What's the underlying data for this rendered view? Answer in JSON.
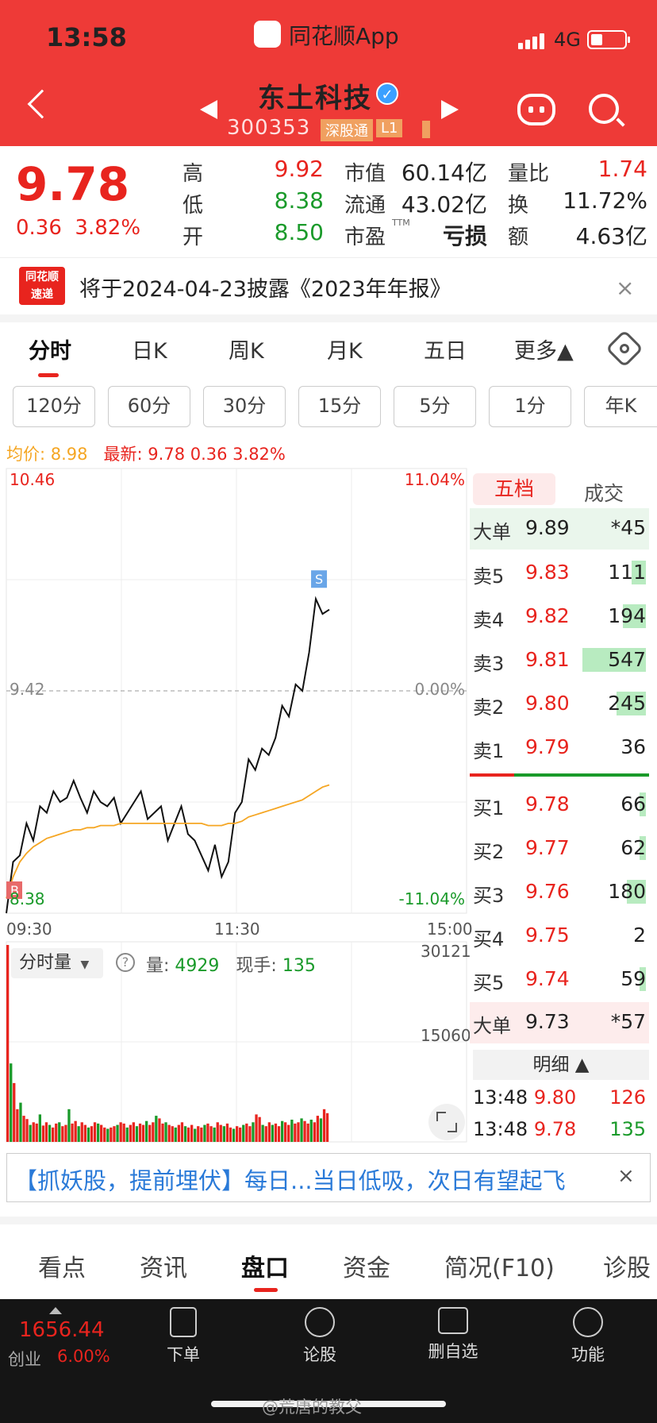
{
  "status_bar": {
    "time": "13:58",
    "app_name": "同花顺App",
    "network": "4G"
  },
  "header": {
    "stock_name": "东土科技",
    "stock_code": "300353",
    "tag_connect": "深股通",
    "tag_level": "L1"
  },
  "quote": {
    "price": "9.78",
    "change": "0.36",
    "change_pct": "3.82%",
    "fields": [
      {
        "label": "高",
        "value": "9.92",
        "color": "#e8241e"
      },
      {
        "label": "低",
        "value": "8.38",
        "color": "#1a9a2a"
      },
      {
        "label": "开",
        "value": "8.50",
        "color": "#1a9a2a"
      },
      {
        "label": "市值",
        "value": "60.14亿",
        "color": "#222222"
      },
      {
        "label": "流通",
        "value": "43.02亿",
        "color": "#222222"
      },
      {
        "label": "市盈",
        "value": "亏损",
        "color": "#222222"
      },
      {
        "label": "量比",
        "value": "1.74",
        "color": "#e8241e"
      },
      {
        "label": "换",
        "value": "11.72%",
        "color": "#222222"
      },
      {
        "label": "额",
        "value": "4.63亿",
        "color": "#222222"
      }
    ],
    "ttm_mark": "TTM"
  },
  "notice": {
    "logo_line1": "同花顺",
    "logo_line2": "速递",
    "text": "将于2024-04-23披露《2023年年报》",
    "close": "×"
  },
  "chart_tabs": [
    "分时",
    "日K",
    "周K",
    "月K",
    "五日",
    "更多▲"
  ],
  "periods": [
    "120分",
    "60分",
    "30分",
    "15分",
    "5分",
    "1分",
    "年K"
  ],
  "summary": {
    "avg_label": "均价: 8.98",
    "latest_label": "最新: 9.78  0.36  3.82%"
  },
  "chart_data": {
    "type": "line",
    "ylim": [
      8.38,
      10.46
    ],
    "y_ticks": {
      "top": "10.46",
      "mid": "9.42",
      "bottom": "8.38"
    },
    "pct_ticks": {
      "top": "11.04%",
      "mid": "0.00%",
      "bottom": "-11.04%"
    },
    "x_ticks": [
      "09:30",
      "11:30",
      "15:00"
    ],
    "marks": {
      "buy": "B",
      "sell": "S"
    },
    "series": [
      {
        "name": "最新",
        "color": "#111111",
        "values": [
          8.38,
          8.62,
          8.65,
          8.8,
          8.72,
          8.88,
          8.85,
          8.95,
          8.9,
          8.92,
          9.0,
          8.92,
          8.85,
          8.95,
          8.9,
          8.88,
          8.92,
          8.8,
          8.85,
          8.9,
          8.95,
          8.82,
          8.85,
          8.88,
          8.72,
          8.8,
          8.88,
          8.75,
          8.72,
          8.65,
          8.58,
          8.7,
          8.55,
          8.62,
          8.85,
          8.9,
          9.1,
          9.05,
          9.15,
          9.12,
          9.2,
          9.35,
          9.3,
          9.45,
          9.42,
          9.6,
          9.85,
          9.78,
          9.8
        ]
      },
      {
        "name": "均价",
        "color": "#f5a623",
        "values": [
          8.45,
          8.55,
          8.62,
          8.66,
          8.69,
          8.71,
          8.73,
          8.74,
          8.75,
          8.76,
          8.77,
          8.77,
          8.78,
          8.78,
          8.79,
          8.79,
          8.79,
          8.8,
          8.8,
          8.8,
          8.8,
          8.8,
          8.8,
          8.8,
          8.8,
          8.8,
          8.8,
          8.8,
          8.8,
          8.8,
          8.79,
          8.79,
          8.79,
          8.8,
          8.8,
          8.81,
          8.83,
          8.84,
          8.85,
          8.86,
          8.87,
          8.88,
          8.89,
          8.9,
          8.91,
          8.93,
          8.95,
          8.97,
          8.98
        ]
      }
    ]
  },
  "volume": {
    "selector": "分时量",
    "help": "?",
    "volume_label": "量:",
    "volume_value": "4929",
    "hand_label": "现手:",
    "hand_value": "135",
    "y_ticks": [
      "30121",
      "15060"
    ],
    "values": [
      30121,
      12000,
      9000,
      5000,
      6000,
      4000,
      3500,
      2600,
      3000,
      2800,
      4200,
      2500,
      3000,
      2600,
      2200,
      2800,
      3000,
      2400,
      2600,
      5000,
      2800,
      3200,
      2400,
      3000,
      2600,
      2200,
      2400,
      3000,
      2800,
      2600,
      2200,
      2000,
      2200,
      2400,
      2600,
      3000,
      2800,
      2200,
      2600,
      3000,
      2400,
      2800,
      2600,
      3200,
      2600,
      3000,
      4000,
      3600,
      2800,
      3000,
      2600,
      2400,
      2200,
      2600,
      3000,
      2400,
      2200,
      2600,
      2000,
      2400,
      2200,
      2600,
      2800,
      2400,
      2200,
      3000,
      2600,
      2400,
      2800,
      2200,
      2000,
      2400,
      2200,
      2600,
      2800,
      2400,
      3000,
      4200,
      3800,
      2600,
      2400,
      3000,
      2600,
      2800,
      2400,
      3200,
      3000,
      2600,
      3400,
      2800,
      3000,
      3600,
      3200,
      2800,
      3400,
      3000,
      4000,
      3600,
      5000,
      4400
    ]
  },
  "order_book": {
    "tab_active": "五档",
    "tab_other": "成交",
    "big_sell": {
      "label": "大单",
      "price": "9.89",
      "qty": "*45"
    },
    "asks": [
      {
        "label": "卖5",
        "price": "9.83",
        "qty": "111",
        "bar": 0.22
      },
      {
        "label": "卖4",
        "price": "9.82",
        "qty": "194",
        "bar": 0.36
      },
      {
        "label": "卖3",
        "price": "9.81",
        "qty": "547",
        "bar": 1.0
      },
      {
        "label": "卖2",
        "price": "9.80",
        "qty": "245",
        "bar": 0.46
      },
      {
        "label": "卖1",
        "price": "9.79",
        "qty": "36",
        "bar": 0.0
      }
    ],
    "bids": [
      {
        "label": "买1",
        "price": "9.78",
        "qty": "66",
        "bar": 0.1
      },
      {
        "label": "买2",
        "price": "9.77",
        "qty": "62",
        "bar": 0.1
      },
      {
        "label": "买3",
        "price": "9.76",
        "qty": "180",
        "bar": 0.3
      },
      {
        "label": "买4",
        "price": "9.75",
        "qty": "2",
        "bar": 0.0
      },
      {
        "label": "买5",
        "price": "9.74",
        "qty": "59",
        "bar": 0.1
      }
    ],
    "big_buy": {
      "label": "大单",
      "price": "9.73",
      "qty": "*57"
    },
    "detail_header": "明细 ▲",
    "trades": [
      {
        "time": "13:48",
        "price": "9.80",
        "qty": "126",
        "color": "#e8241e"
      },
      {
        "time": "13:48",
        "price": "9.78",
        "qty": "135",
        "color": "#1a9a2a"
      }
    ]
  },
  "ad": {
    "text": "【抓妖股，提前埋伏】每日...当日低吸，次日有望起飞",
    "close": "×"
  },
  "bottom_tabs": [
    "看点",
    "资讯",
    "盘口",
    "资金",
    "简况(F10)",
    "诊股"
  ],
  "bottom_nav": {
    "index_value": "1656.44",
    "index_name": "创业",
    "index_pct": "6.00%",
    "items": [
      "下单",
      "论股",
      "删自选",
      "功能"
    ]
  },
  "watermark": "@荒唐的教父"
}
